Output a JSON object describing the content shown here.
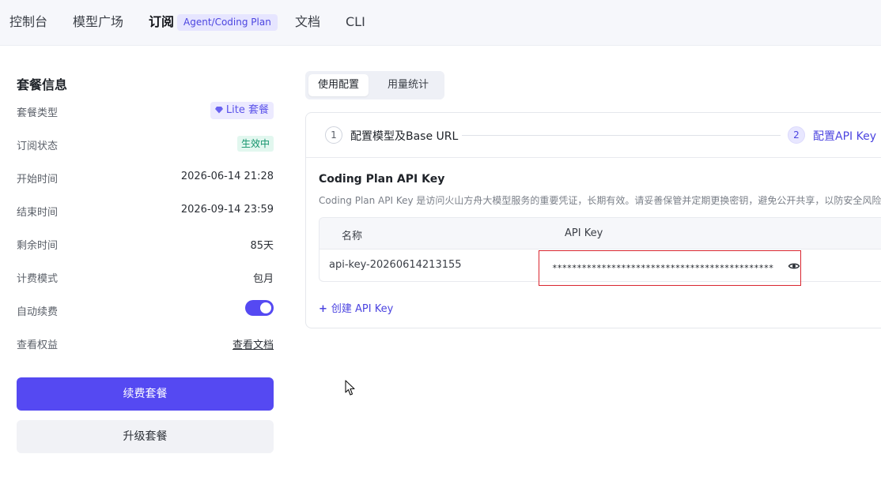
{
  "nav": {
    "items": [
      "控制台",
      "模型广场",
      "订阅",
      "文档",
      "CLI"
    ],
    "badge": "Agent/Coding Plan"
  },
  "plan": {
    "title": "套餐信息",
    "rows": {
      "type": {
        "label": "套餐类型",
        "value": "Lite 套餐"
      },
      "status": {
        "label": "订阅状态",
        "value": "生效中"
      },
      "start": {
        "label": "开始时间",
        "value": "2026-06-14 21:28"
      },
      "end": {
        "label": "结束时间",
        "value": "2026-09-14 23:59"
      },
      "remaining": {
        "label": "剩余时间",
        "value": "85天"
      },
      "billing": {
        "label": "计费模式",
        "value": "包月"
      },
      "auto_renew": {
        "label": "自动续费",
        "enabled": true
      },
      "benefits": {
        "label": "查看权益",
        "link": "查看文档"
      }
    },
    "renew_button": "续费套餐",
    "upgrade_button": "升级套餐"
  },
  "tabs": [
    "使用配置",
    "用量统计"
  ],
  "steps": [
    {
      "num": "1",
      "label": "配置模型及Base URL"
    },
    {
      "num": "2",
      "label": "配置API Key"
    }
  ],
  "api_key": {
    "title": "Coding Plan API Key",
    "description": "Coding Plan API Key 是访问火山方舟大模型服务的重要凭证，长期有效。请妥善保管并定期更换密钥，避免公开共享，以防安全风险和",
    "columns": [
      "名称",
      "API Key"
    ],
    "rows": [
      {
        "name": "api-key-20260614213155",
        "key": "*********************************************"
      }
    ],
    "create_label": "创建 API Key"
  },
  "colors": {
    "accent": "#5549f2",
    "accent_text": "#4c45e0",
    "status_green": "#12936b",
    "highlight_red": "#d9252f"
  },
  "icons": {
    "gem": "diamond-icon",
    "eye": "eye-icon",
    "plus": "plus-icon",
    "cursor": "mouse-cursor-icon"
  }
}
